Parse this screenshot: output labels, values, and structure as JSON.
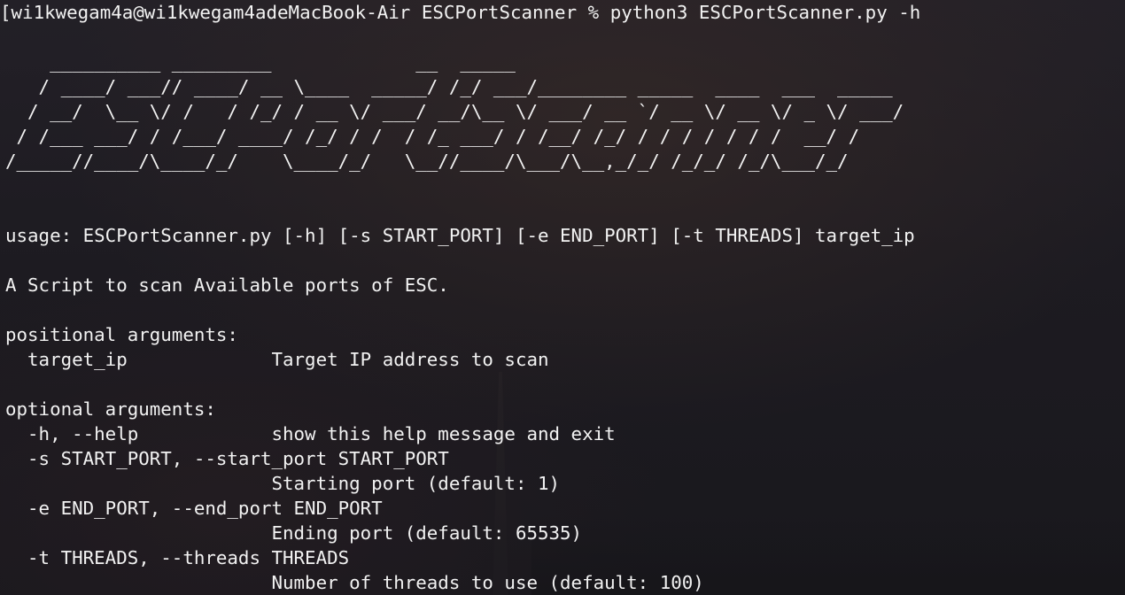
{
  "prompt": {
    "bracket": "[",
    "user_host": "wi1kwegam4a@wi1kwegam4adeMacBook-Air",
    "cwd": "ESCPortScanner",
    "symbol": "%",
    "command": "python3 ESCPortScanner.py -h"
  },
  "banner": [
    "    __________ _________             __  _____",
    "   / ____/ ___// ____/ __ \\____  _____/ /_/ ___/________ _____  ____  ___  _____",
    "  / __/  \\__ \\/ /   / /_/ / __ \\/ ___/ __/\\__ \\/ ___/ __ `/ __ \\/ __ \\/ _ \\/ ___/",
    " / /___ ___/ / /___/ ____/ /_/ / /  / /_ ___/ / /__/ /_/ / / / / / / /  __/ /",
    "/_____//____/\\____/_/    \\____/_/   \\__//____/\\___/\\__,_/_/ /_/_/ /_/\\___/_/"
  ],
  "usage": "usage: ESCPortScanner.py [-h] [-s START_PORT] [-e END_PORT] [-t THREADS] target_ip",
  "description": "A Script to scan Available ports of ESC.",
  "positional": {
    "header": "positional arguments:",
    "items": [
      {
        "flag": "  target_ip             ",
        "help": "Target IP address to scan"
      }
    ]
  },
  "optional": {
    "header": "optional arguments:",
    "help_flag": "  -h, --help            ",
    "help_text": "show this help message and exit",
    "start_flag": "  -s START_PORT, --start_port START_PORT",
    "start_help": "                        Starting port (default: 1)",
    "end_flag": "  -e END_PORT, --end_port END_PORT",
    "end_help": "                        Ending port (default: 65535)",
    "threads_flag": "  -t THREADS, --threads THREADS",
    "threads_help": "                        Number of threads to use (default: 100)"
  }
}
